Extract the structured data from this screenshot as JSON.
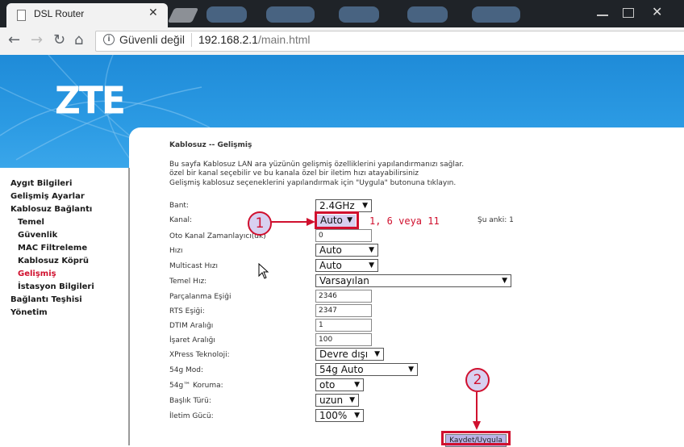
{
  "browser": {
    "tab_title": "DSL Router",
    "tab_close": "✕",
    "security_label": "Güvenli değil",
    "url_host": "192.168.2.1",
    "url_path": "/main.html"
  },
  "logo": "ZTE",
  "sidebar": {
    "items": [
      {
        "label": "Aygıt Bilgileri"
      },
      {
        "label": "Gelişmiş Ayarlar"
      },
      {
        "label": "Kablosuz Bağlantı"
      },
      {
        "label": "Temel"
      },
      {
        "label": "Güvenlik"
      },
      {
        "label": "MAC Filtreleme"
      },
      {
        "label": "Kablosuz Köprü"
      },
      {
        "label": "Gelişmiş"
      },
      {
        "label": "İstasyon Bilgileri"
      },
      {
        "label": "Bağlantı Teşhisi"
      },
      {
        "label": "Yönetim"
      }
    ]
  },
  "page": {
    "title": "Kablosuz -- Gelişmiş",
    "desc1": "Bu sayfa Kablosuz LAN ara yüzünün gelişmiş özelliklerini yapılandırmanızı sağlar.",
    "desc2": "özel bir kanal seçebilir ve bu kanala özel bir iletim hızı atayabilirsiniz",
    "desc3": "Gelişmiş kablosuz seçeneklerini yapılandırmak için \"Uygula\" butonuna tıklayın."
  },
  "form": {
    "band": {
      "label": "Bant:",
      "value": "2.4GHz"
    },
    "channel": {
      "label": "Kanal:",
      "value": "Auto",
      "current": "Şu anki: 1"
    },
    "auto_channel_timer": {
      "label": "Oto Kanal Zamanlayıcı(dk)",
      "value": "0"
    },
    "rate": {
      "label": "Hızı",
      "value": "Auto"
    },
    "multicast_rate": {
      "label": "Multicast Hızı",
      "value": "Auto"
    },
    "basic_rate": {
      "label": "Temel Hız:",
      "value": "Varsayılan"
    },
    "frag_threshold": {
      "label": "Parçalanma Eşiği",
      "value": "2346"
    },
    "rts_threshold": {
      "label": "RTS Eşiği:",
      "value": "2347"
    },
    "dtim_interval": {
      "label": "DTIM Aralığı",
      "value": "1"
    },
    "beacon_interval": {
      "label": "İşaret Aralığı",
      "value": "100"
    },
    "xpress": {
      "label": "XPress Teknoloji:",
      "value": "Devre dışı"
    },
    "mode_54g": {
      "label": "54g Mod:",
      "value": "54g Auto"
    },
    "protection_54g": {
      "label": "54g™ Koruma:",
      "value": "oto"
    },
    "preamble": {
      "label": "Başlık Türü:",
      "value": "uzun"
    },
    "tx_power": {
      "label": "İletim Gücü:",
      "value": "100%"
    },
    "save_label": "Kaydet/Uygula"
  },
  "annotations": {
    "step1": "1",
    "step2": "2",
    "channel_hint": "1, 6 veya 11",
    "accent_color": "#d0102e"
  }
}
